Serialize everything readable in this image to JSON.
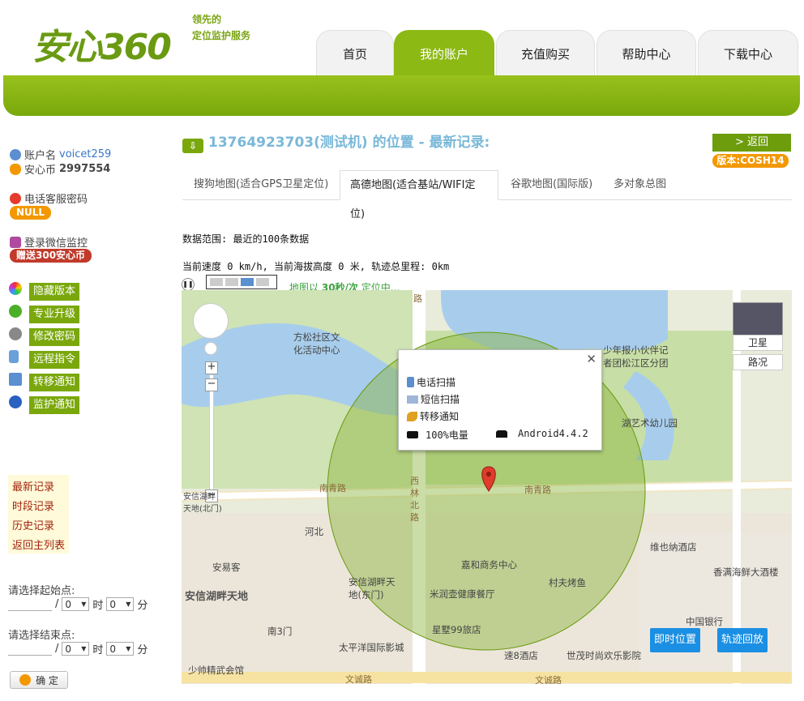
{
  "header": {
    "logo_text": "安心360",
    "slogan_line1": "领先的",
    "slogan_line2": "定位监护服务",
    "nav": [
      "首页",
      "我的账户",
      "充值购买",
      "帮助中心",
      "下载中心"
    ]
  },
  "sidebar": {
    "account_label": "账户名",
    "account_value": "voicet259",
    "coin_label": "安心币",
    "coin_value": "2997554",
    "phone_pw_label": "电话客服密码",
    "phone_pw_value": "NULL",
    "wechat_label": "登录微信监控",
    "wechat_bonus": "赠送300安心币",
    "menu": [
      "隐藏版本",
      "专业升级",
      "修改密码",
      "远程指令",
      "转移通知",
      "监护通知"
    ],
    "records": [
      "最新记录",
      "时段记录",
      "历史记录",
      "返回主列表"
    ],
    "start_label": "请选择起始点:",
    "end_label": "请选择结束点:",
    "hour_value": "0",
    "minute_value": "0",
    "hour_unit": "时",
    "minute_unit": "分",
    "slash": "/",
    "ok_label": "确 定"
  },
  "content": {
    "title": "13764923703(测试机) 的位置 - 最新记录:",
    "back_label": "> 返回",
    "version_label": "版本:COSH14",
    "map_tabs": [
      "搜狗地图(适合GPS卫星定位)",
      "高德地图(适合基站/WIFI定位)",
      "谷歌地图(国际版)",
      "多对象总图"
    ],
    "data_range": "数据范围: 最近的100条数据",
    "speed_line": "当前速度 0 km/h, 当前海拔高度 0 米, 轨迹总里程: 0km",
    "refresh_prefix": "地图以",
    "refresh_rate": "30秒/次",
    "refresh_suffix": "定位中..."
  },
  "map": {
    "satellite_label": "卫星",
    "traffic_label": "路况",
    "popup": {
      "phone_scan": "电话扫描",
      "sms_scan": "短信扫描",
      "transfer": "转移通知",
      "battery": "100%电量",
      "os": "Android4.4.2"
    },
    "labels": {
      "fangsong": "方松社区文化活动中心",
      "shaonian": "少年报小伙伴记者团松江区分团",
      "kindergarten": "湖艺术幼儿园",
      "nanqing_w": "南青路",
      "nanqing_e": "南青路",
      "xilin": "西林北路",
      "hebei": "河北",
      "anyi": "安易客",
      "anxin_gate": "安信湖畔天地(北门)",
      "anxin_east": "安信湖畔天地(东门)",
      "anxin": "安信湖畔天地",
      "jiahe": "嘉和商务中心",
      "cunfu": "村夫烤鱼",
      "mirun": "米润壶健康餐厅",
      "weiye": "维也纳酒店",
      "xiangman": "香满海鲜大酒楼",
      "bank": "中国银行",
      "nan3": "南3门",
      "xingxing": "星墅99旅店",
      "taipingyang": "太平洋国际影城",
      "su8": "速8酒店",
      "shimao": "世茂时尚欢乐影院",
      "wencheng1": "文诚路",
      "wencheng2": "文诚路",
      "shaoshuai": "少帅精武会馆",
      "lu_top": "路"
    },
    "btn_now": "即时位置",
    "btn_track": "轨迹回放"
  }
}
